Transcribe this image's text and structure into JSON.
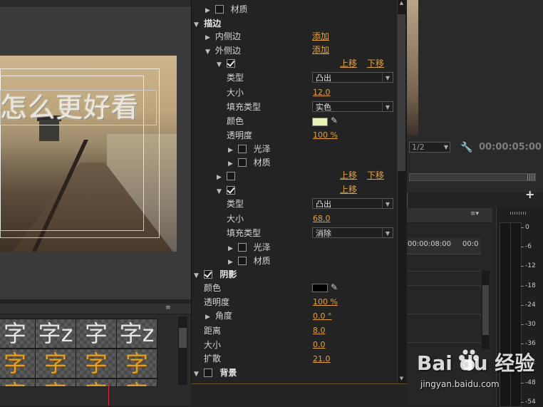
{
  "left_monitor": {
    "title_text": "怎么更好看"
  },
  "style_library": {
    "menu_glyph": "≡",
    "swatches_row1": [
      "字",
      "字z",
      "字",
      "字z"
    ],
    "swatches_row2": [
      "字",
      "字",
      "字",
      "字"
    ],
    "swatches_row3": [
      "字",
      "字",
      "字",
      "字"
    ]
  },
  "properties": {
    "sheen_row_top": {
      "label": "材质",
      "checked": false
    },
    "stroke": {
      "label": "描边",
      "inner": {
        "label": "内侧边",
        "add": "添加"
      },
      "outer": {
        "label": "外侧边",
        "add": "添加"
      },
      "stroke1": {
        "move_up": "上移",
        "move_down": "下移",
        "type_label": "类型",
        "type_value": "凸出",
        "size_label": "大小",
        "size_value": "12.0",
        "fill_label": "填充类型",
        "fill_value": "实色",
        "color_label": "颜色",
        "color": "#e9f2b6",
        "opacity_label": "透明度",
        "opacity_value": "100 %",
        "sheen_label": "光泽",
        "texture_label": "材质"
      },
      "stroke2": {
        "move_up": "上移",
        "move_down": "下移"
      },
      "stroke3": {
        "move_up": "上移",
        "type_label": "类型",
        "type_value": "凸出",
        "size_label": "大小",
        "size_value": "68.0",
        "fill_label": "填充类型",
        "fill_value": "消除",
        "sheen_label": "光泽",
        "texture_label": "材质"
      }
    },
    "shadow": {
      "label": "阴影",
      "color_label": "颜色",
      "color": "#000000",
      "opacity_label": "透明度",
      "opacity_value": "100 %",
      "angle_label": "角度",
      "angle_value": "0.0 °",
      "distance_label": "距离",
      "distance_value": "8.0",
      "size_label": "大小",
      "size_value": "0.0",
      "spread_label": "扩散",
      "spread_value": "21.0"
    },
    "background": {
      "label": "背景"
    }
  },
  "source_monitor": {
    "zoom": "1/2",
    "timecode": "00:00:05:00",
    "add_icon": "+"
  },
  "timeline": {
    "menu_glyph": "≡▾",
    "ruler_time1": "00:00:08:00",
    "ruler_time2": "00:0"
  },
  "audio_meter": {
    "labels": [
      "0",
      "-6",
      "-12",
      "-18",
      "-24",
      "-30",
      "-36",
      "-42",
      "-48",
      "-54"
    ]
  },
  "watermark": {
    "logo": "Bai  du 经验",
    "url": "jingyan.baidu.com"
  },
  "colors": {
    "accent": "#e3a33a",
    "panel_border": "#6b4e2a"
  }
}
